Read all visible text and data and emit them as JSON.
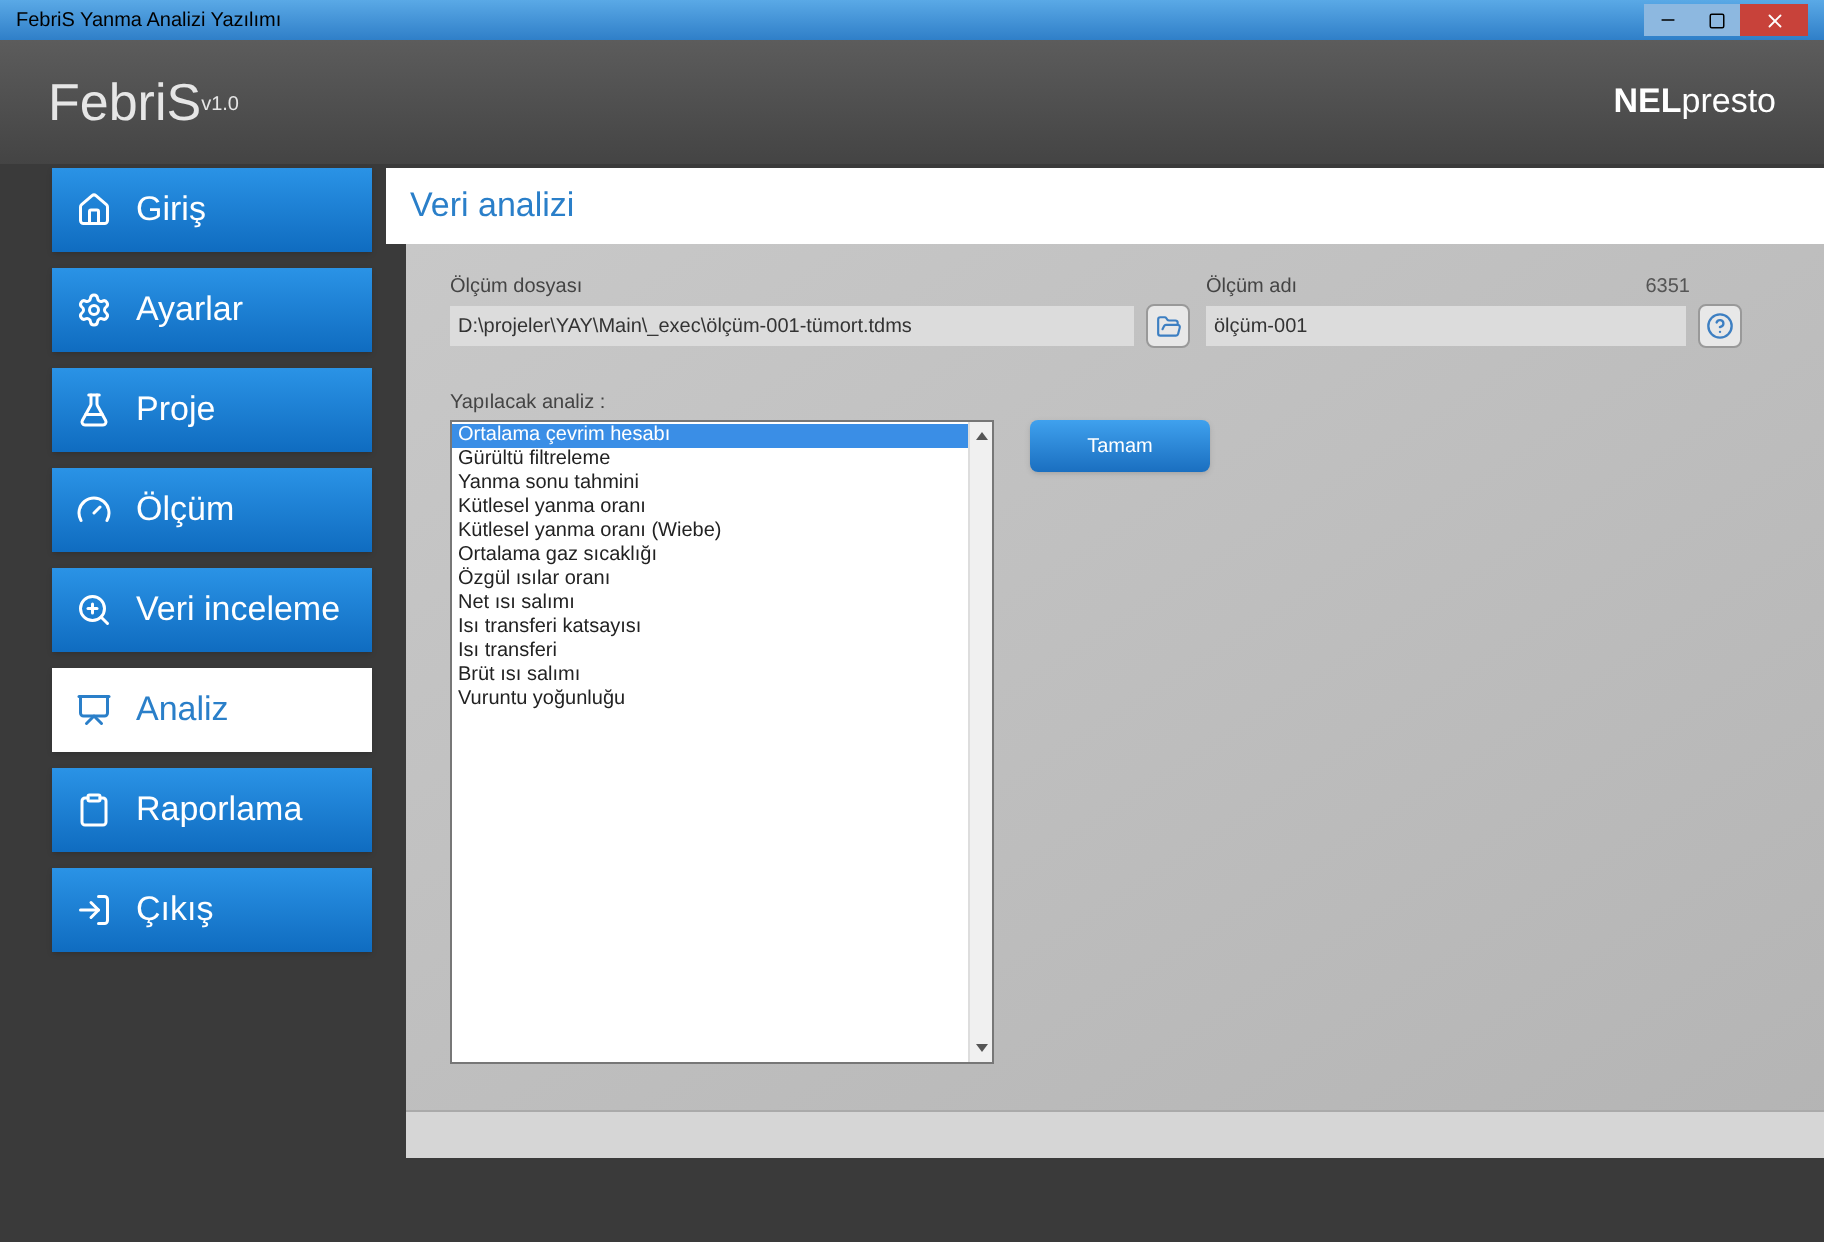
{
  "window": {
    "title": "FebriS Yanma Analizi Yazılımı"
  },
  "header": {
    "app_name": "FebriS$^{v1.0}$",
    "logo": "**NEL**presto"
  },
  "nav": [
    {
      "label": "Giriş",
      "selected": false
    },
    {
      "label": "Ayarlar",
      "selected": false
    },
    {
      "label": "Proje",
      "selected": false
    },
    {
      "label": "Ölçüm",
      "selected": false
    },
    {
      "label": "Veri inceleme",
      "selected": false
    },
    {
      "label": "Analiz",
      "selected": true
    },
    {
      "label": "Raporlama",
      "selected": false
    },
    {
      "label": "Çıkış",
      "selected": false
    }
  ],
  "page_title": "Veri analizi",
  "file_field": {
    "label": "Ölçüm dosyası",
    "value": "D:\\projeler\\YAY\\Main\\_exec\\ölçüm-001-tümort.tdms"
  },
  "name_field": {
    "label": "Ölçüm adı",
    "count": "6351",
    "value": "ölçüm-001"
  },
  "analysis": {
    "label": "Yapılacak analiz :",
    "items": [
      {
        "label": "Ortalama çevrim hesabı",
        "selected": true
      },
      {
        "label": "Gürültü filtreleme",
        "selected": false
      },
      {
        "label": "Yanma sonu tahmini",
        "selected": false
      },
      {
        "label": "Kütlesel yanma oranı",
        "selected": false
      },
      {
        "label": "Kütlesel yanma oranı (Wiebe)",
        "selected": false
      },
      {
        "label": "Ortalama gaz sıcaklığı",
        "selected": false
      },
      {
        "label": "Özgül ısılar oranı",
        "selected": false
      },
      {
        "label": "Net ısı salımı",
        "selected": false
      },
      {
        "label": "Isı transferi katsayısı",
        "selected": false
      },
      {
        "label": "Isı transferi",
        "selected": false
      },
      {
        "label": "Brüt ısı salımı",
        "selected": false
      },
      {
        "label": "Vuruntu yoğunluğu",
        "selected": false
      }
    ]
  },
  "ok_button": "Tamam"
}
